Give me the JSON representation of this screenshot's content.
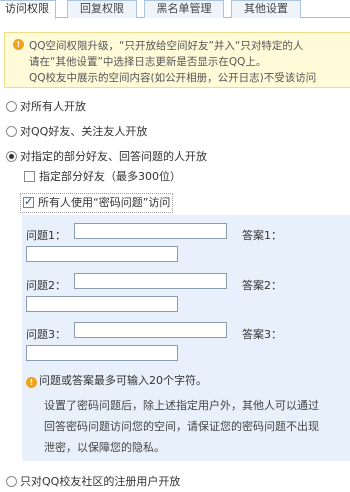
{
  "tabs": [
    {
      "label": "访问权限",
      "active": true
    },
    {
      "label": "回复权限",
      "active": false
    },
    {
      "label": "黑名单管理",
      "active": false
    },
    {
      "label": "其他设置",
      "active": false
    }
  ],
  "notice": {
    "line1": "QQ空间权限升级，“只开放给空间好友”并入“只对特定的人",
    "line2": "请在“其他设置”中选择日志更新是否显示在QQ上。",
    "line3": "QQ校友中展示的空间内容(如公开相册，公开日志)不受该访问"
  },
  "options": {
    "all": "对所有人开放",
    "friends": "对QQ好友、关注友人开放",
    "specific": "对指定的部分好友、回答问题的人开放",
    "campus": "只对QQ校友社区的注册用户开放"
  },
  "sub": {
    "specific_friends": "指定部分好友（最多300位）",
    "password_question": "所有人使用“密码问题”访问"
  },
  "questions": [
    {
      "q_label": "问题1：",
      "a_label": "答案1：",
      "q_value": "",
      "a_value": ""
    },
    {
      "q_label": "问题2：",
      "a_label": "答案2：",
      "q_value": "",
      "a_value": ""
    },
    {
      "q_label": "问题3：",
      "a_label": "答案3：",
      "q_value": "",
      "a_value": ""
    }
  ],
  "hint": "问题或答案最多可输入20个字符。",
  "description": {
    "line1": "设置了密码问题后，除上述指定用户外，其他人可以通过",
    "line2": "回答密码问题访问您的空间，请保证您的密码问题不出现",
    "line3": "泄密，以保障您的隐私。"
  }
}
